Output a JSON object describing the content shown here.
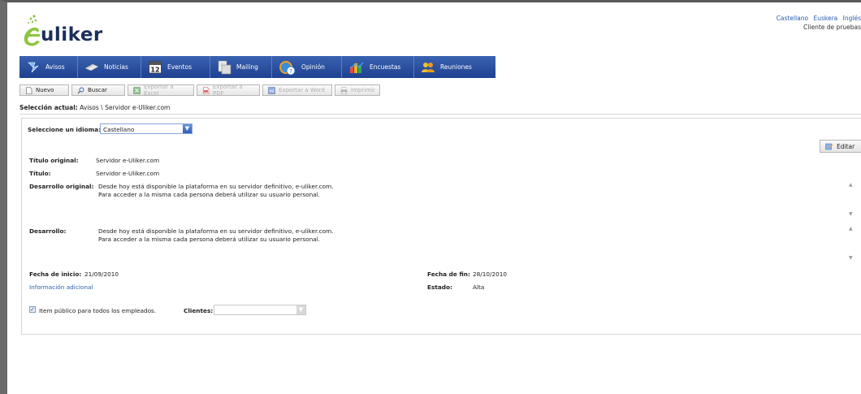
{
  "header": {
    "logo_text": "uliker",
    "languages": [
      "Castellano",
      "Euskera",
      "Inglés"
    ],
    "client_label": "Cliente de pruebas"
  },
  "nav": {
    "items": [
      {
        "label": "Avisos",
        "icon": "pin-icon"
      },
      {
        "label": "Noticias",
        "icon": "newspaper-icon"
      },
      {
        "label": "Eventos",
        "icon": "calendar-icon",
        "icon_text": "12"
      },
      {
        "label": "Mailing",
        "icon": "mail-document-icon"
      },
      {
        "label": "Opinión",
        "icon": "opinion-globe-icon"
      },
      {
        "label": "Encuestas",
        "icon": "survey-chart-icon"
      },
      {
        "label": "Reuniones",
        "icon": "meeting-people-icon"
      }
    ]
  },
  "toolbar": {
    "buttons": [
      {
        "label": "Nuevo",
        "icon": "new-document-icon",
        "enabled": true
      },
      {
        "label": "Buscar",
        "icon": "magnifier-icon",
        "enabled": true
      },
      {
        "label": "Exportar a Excel",
        "icon": "excel-icon",
        "enabled": false
      },
      {
        "label": "Exportar a PDF",
        "icon": "pdf-icon",
        "enabled": false
      },
      {
        "label": "Exportar a Word",
        "icon": "word-icon",
        "enabled": false
      },
      {
        "label": "Imprimir",
        "icon": "printer-icon",
        "enabled": false
      }
    ]
  },
  "selection": {
    "label": "Selección actual:",
    "path": "Avisos \\ Servidor e-Uliker.com"
  },
  "detail": {
    "language_label": "Seleccione un idioma:",
    "language_value": "Castellano",
    "edit_label": "Editar",
    "titulo_original_label": "Título original:",
    "titulo_original": "Servidor e-Uliker.com",
    "titulo_label": "Título:",
    "titulo": "Servidor e-Uliker.com",
    "desarrollo_original_label": "Desarrollo original:",
    "desarrollo_original_line1": "Desde hoy está disponible la plataforma en su servidor definitivo, e-uliker.com.",
    "desarrollo_original_line2": "Para acceder a la misma cada persona deberá utilizar su usuario personal.",
    "desarrollo_label": "Desarrollo:",
    "desarrollo_line1": "Desde hoy está disponible la plataforma en su servidor definitivo, e-uliker.com.",
    "desarrollo_line2": "Para acceder a la misma cada persona deberá utilizar su usuario personal.",
    "fecha_inicio_label": "Fecha de inicio:",
    "fecha_inicio": "21/09/2010",
    "fecha_fin_label": "Fecha de fin:",
    "fecha_fin": "28/10/2010",
    "info_adicional": "Información adicional",
    "estado_label": "Estado:",
    "estado": "Alta",
    "publico_label": "Item público para todos los empleados.",
    "publico_checked": true,
    "clientes_label": "Clientes:",
    "clientes_value": ""
  },
  "colors": {
    "nav_bg": "#2a4fa0",
    "link": "#2a5db0",
    "logo": "#1a2f5a",
    "logo_accent": "#8cc63f"
  }
}
